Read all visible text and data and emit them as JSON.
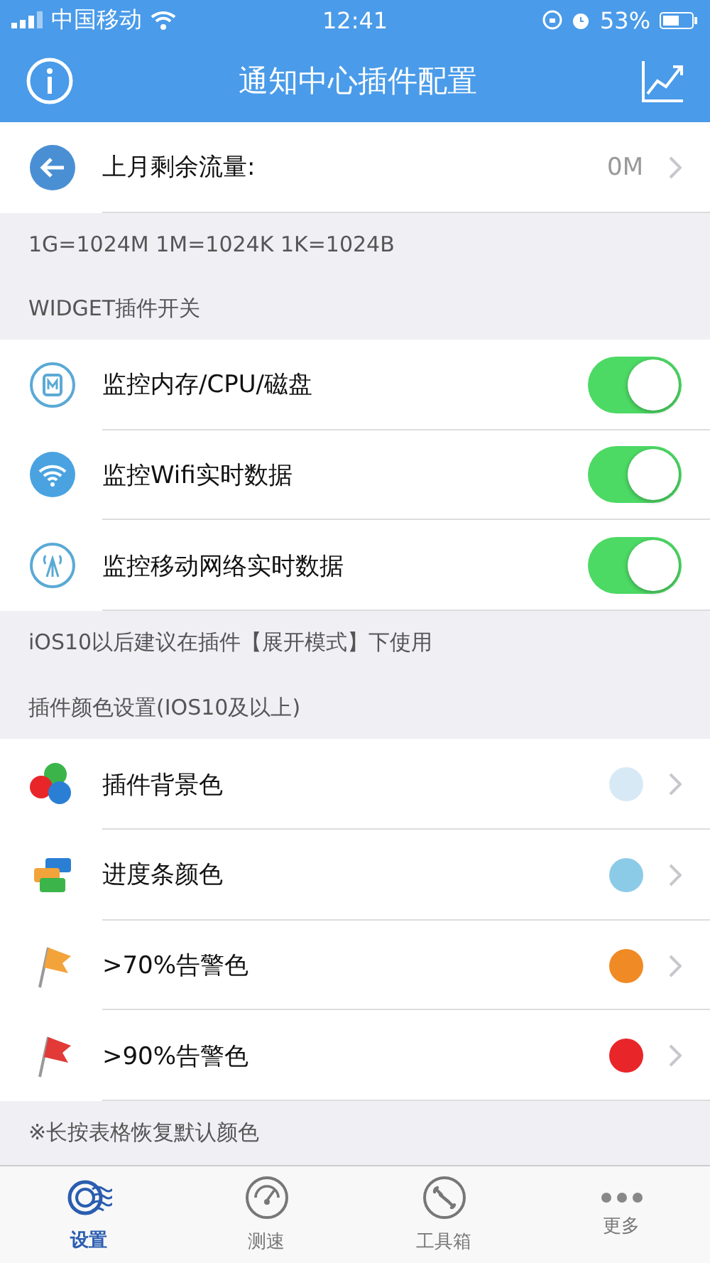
{
  "status_bar": {
    "carrier": "中国移动",
    "time": "12:41",
    "battery": "53%"
  },
  "nav_bar": {
    "title": "通知中心插件配置"
  },
  "traffic_row": {
    "label": "上月剩余流量:",
    "value": "0M"
  },
  "unit_note": "1G=1024M  1M=1024K  1K=1024B",
  "widget_section": {
    "header": "WIDGET插件开关",
    "items": [
      {
        "label": "监控内存/CPU/磁盘",
        "on": true
      },
      {
        "label": "监控Wifi实时数据",
        "on": true
      },
      {
        "label": "监控移动网络实时数据",
        "on": true
      }
    ],
    "footer": "iOS10以后建议在插件【展开模式】下使用"
  },
  "color_section": {
    "header": "插件颜色设置(IOS10及以上)",
    "items": [
      {
        "label": "插件背景色",
        "color": "#d8e9f6"
      },
      {
        "label": "进度条颜色",
        "color": "#8ccbe8"
      },
      {
        "label": ">70%告警色",
        "color": "#f08a24"
      },
      {
        "label": ">90%告警色",
        "color": "#e8262a"
      }
    ],
    "footer": "※长按表格恢复默认颜色"
  },
  "tab_bar": [
    {
      "label": "设置",
      "selected": true
    },
    {
      "label": "测速",
      "selected": false
    },
    {
      "label": "工具箱",
      "selected": false
    },
    {
      "label": "更多",
      "selected": false
    }
  ]
}
